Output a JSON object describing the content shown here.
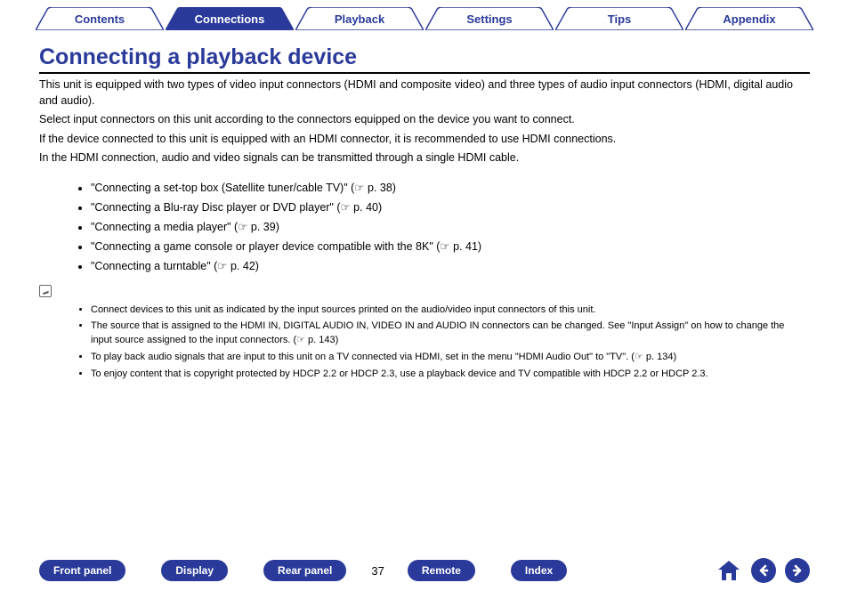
{
  "tabs": {
    "contents": "Contents",
    "connections": "Connections",
    "playback": "Playback",
    "settings": "Settings",
    "tips": "Tips",
    "appendix": "Appendix"
  },
  "title": "Connecting a playback device",
  "paragraphs": {
    "p1": "This unit is equipped with two types of video input connectors (HDMI and composite video) and three types of audio input connectors (HDMI, digital audio and audio).",
    "p2": "Select input connectors on this unit according to the connectors equipped on the device you want to connect.",
    "p3": "If the device connected to this unit is equipped with an HDMI connector, it is recommended to use HDMI connections.",
    "p4": "In the HDMI connection, audio and video signals can be transmitted through a single HDMI cable."
  },
  "link_items": {
    "l1": "\"Connecting a set-top box (Satellite tuner/cable TV)\" (☞ p. 38)",
    "l2": "\"Connecting a Blu-ray Disc player or DVD player\" (☞ p. 40)",
    "l3": "\"Connecting a media player\" (☞ p. 39)",
    "l4": "\"Connecting a game console or player device compatible with the 8K\" (☞ p. 41)",
    "l5": "\"Connecting a turntable\" (☞ p. 42)"
  },
  "notes": {
    "n1": "Connect devices to this unit as indicated by the input sources printed on the audio/video input connectors of this unit.",
    "n2": "The source that is assigned to the HDMI IN, DIGITAL AUDIO IN, VIDEO IN and AUDIO IN connectors can be changed. See \"Input Assign\" on how to change the input source assigned to the input connectors.  (☞ p. 143)",
    "n3": "To play back audio signals that are input to this unit on a TV connected via HDMI, set in the menu \"HDMI Audio Out\" to \"TV\".  (☞ p. 134)",
    "n4": "To enjoy content that is copyright protected by HDCP 2.2 or HDCP 2.3, use a playback device and TV compatible with HDCP 2.2 or HDCP 2.3."
  },
  "bottom": {
    "front_panel": "Front panel",
    "display": "Display",
    "rear_panel": "Rear panel",
    "remote": "Remote",
    "index": "Index",
    "page": "37"
  },
  "colors": {
    "brand": "#2a3a9a"
  }
}
